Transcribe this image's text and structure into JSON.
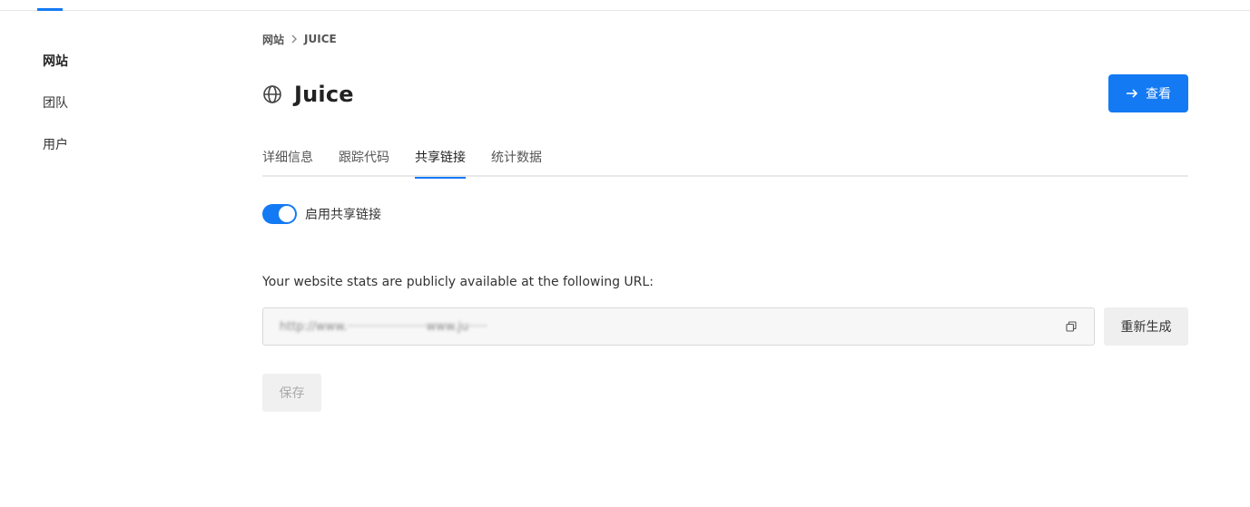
{
  "sidebar": {
    "items": [
      {
        "label": "网站",
        "active": true
      },
      {
        "label": "团队",
        "active": false
      },
      {
        "label": "用户",
        "active": false
      }
    ]
  },
  "breadcrumb": {
    "root": "网站",
    "current": "JUICE"
  },
  "header": {
    "title": "Juice",
    "view_button": "查看"
  },
  "tabs": [
    {
      "label": "详细信息",
      "active": false
    },
    {
      "label": "跟踪代码",
      "active": false
    },
    {
      "label": "共享链接",
      "active": true
    },
    {
      "label": "统计数据",
      "active": false
    }
  ],
  "share": {
    "toggle_label": "启用共享链接",
    "toggle_on": true,
    "description": "Your website stats are publicly available at the following URL:",
    "url_value": "http://www.·····················www.ju·····",
    "regenerate_button": "重新生成",
    "save_button": "保存"
  },
  "colors": {
    "accent": "#147af3"
  }
}
